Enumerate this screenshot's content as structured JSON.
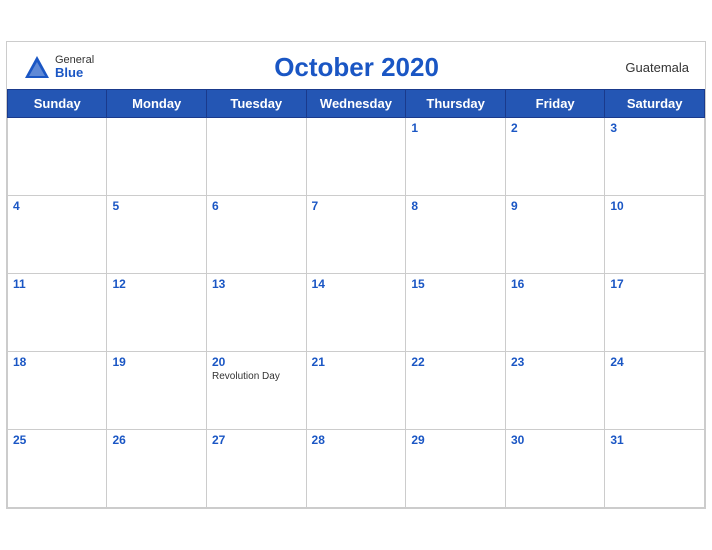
{
  "header": {
    "logo": {
      "general": "General",
      "blue": "Blue",
      "icon": "▲"
    },
    "title": "October 2020",
    "country": "Guatemala"
  },
  "weekdays": [
    "Sunday",
    "Monday",
    "Tuesday",
    "Wednesday",
    "Thursday",
    "Friday",
    "Saturday"
  ],
  "weeks": [
    [
      {
        "day": "",
        "events": []
      },
      {
        "day": "",
        "events": []
      },
      {
        "day": "",
        "events": []
      },
      {
        "day": "",
        "events": []
      },
      {
        "day": "1",
        "events": []
      },
      {
        "day": "2",
        "events": []
      },
      {
        "day": "3",
        "events": []
      }
    ],
    [
      {
        "day": "4",
        "events": []
      },
      {
        "day": "5",
        "events": []
      },
      {
        "day": "6",
        "events": []
      },
      {
        "day": "7",
        "events": []
      },
      {
        "day": "8",
        "events": []
      },
      {
        "day": "9",
        "events": []
      },
      {
        "day": "10",
        "events": []
      }
    ],
    [
      {
        "day": "11",
        "events": []
      },
      {
        "day": "12",
        "events": []
      },
      {
        "day": "13",
        "events": []
      },
      {
        "day": "14",
        "events": []
      },
      {
        "day": "15",
        "events": []
      },
      {
        "day": "16",
        "events": []
      },
      {
        "day": "17",
        "events": []
      }
    ],
    [
      {
        "day": "18",
        "events": []
      },
      {
        "day": "19",
        "events": []
      },
      {
        "day": "20",
        "events": [
          "Revolution Day"
        ]
      },
      {
        "day": "21",
        "events": []
      },
      {
        "day": "22",
        "events": []
      },
      {
        "day": "23",
        "events": []
      },
      {
        "day": "24",
        "events": []
      }
    ],
    [
      {
        "day": "25",
        "events": []
      },
      {
        "day": "26",
        "events": []
      },
      {
        "day": "27",
        "events": []
      },
      {
        "day": "28",
        "events": []
      },
      {
        "day": "29",
        "events": []
      },
      {
        "day": "30",
        "events": []
      },
      {
        "day": "31",
        "events": []
      }
    ]
  ]
}
